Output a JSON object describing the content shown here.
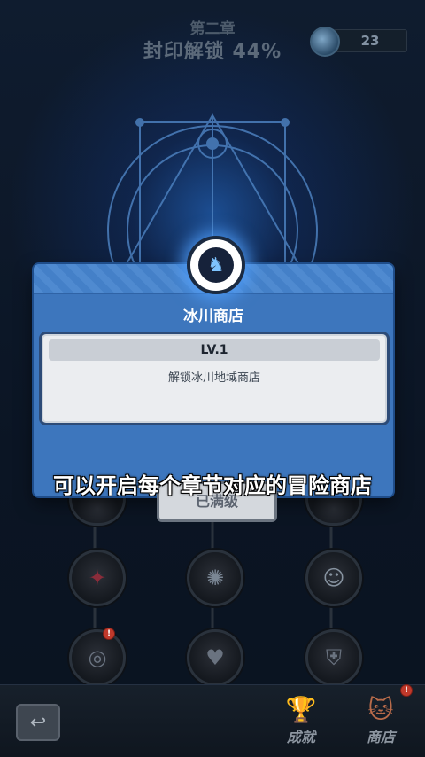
{
  "header": {
    "chapter": "第二章",
    "seal_progress": "封印解锁 44%",
    "currency_value": "23",
    "currency_icon": "crystal-icon"
  },
  "dialog": {
    "title": "冰川商店",
    "emblem_icon": "cat-shop-icon",
    "level": "LV.1",
    "description": "解锁冰川地域商店",
    "bottom_button": "已满级"
  },
  "subtitle": "可以开启每个章节对应的冒险商店",
  "tree_nodes": [
    {
      "icon": "bat-icon"
    },
    {
      "icon": "burst-icon"
    },
    {
      "icon": "angel-icon"
    },
    {
      "icon": "coin-icon"
    },
    {
      "icon": "heart-icon"
    },
    {
      "icon": "shield-icon"
    }
  ],
  "footer": {
    "back_icon": "back-arrow-icon",
    "achievements_label": "成就",
    "shop_label": "商店",
    "shop_badge": "!",
    "node_badge": "!"
  },
  "colors": {
    "dialog_blue": "#3d76bd",
    "card_bg": "#ebedf0",
    "badge_red": "#c0392b"
  }
}
